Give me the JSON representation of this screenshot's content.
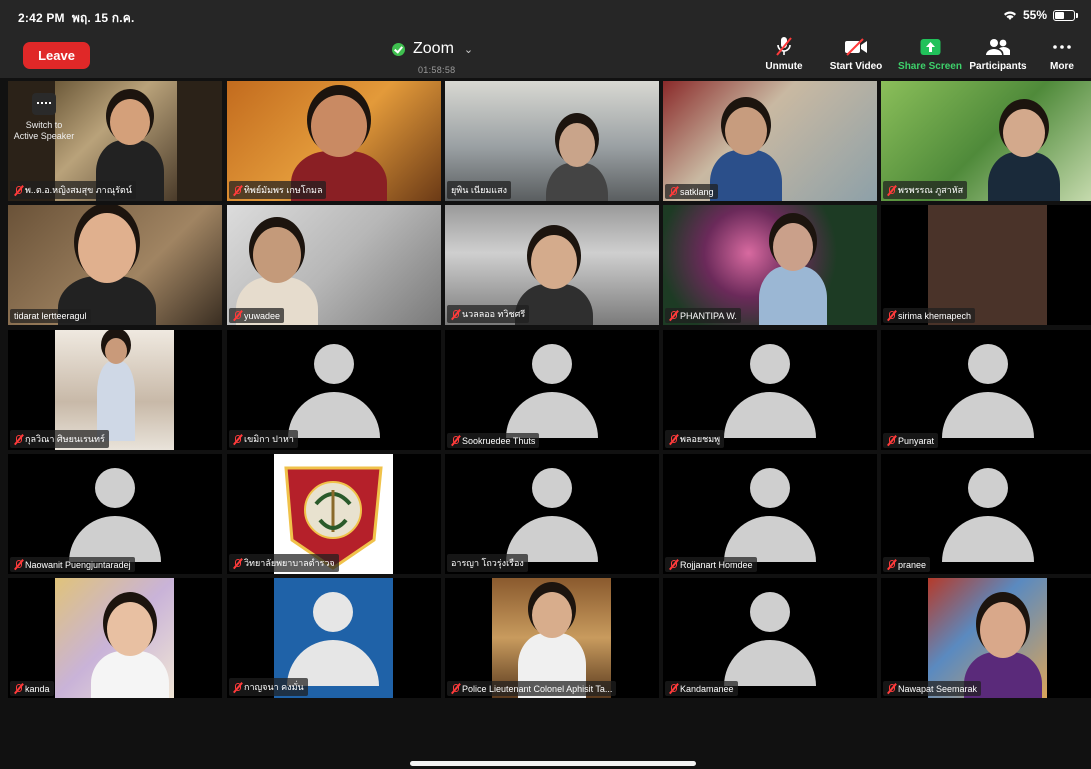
{
  "status": {
    "time": "2:42 PM",
    "date": "พฤ. 15 ก.ค.",
    "battery": "55%",
    "battery_level": 0.55
  },
  "toolbar": {
    "leave_label": "Leave",
    "meeting_title": "Zoom",
    "timer": "01:58:58",
    "controls": [
      {
        "label": "Unmute",
        "icon": "mic-muted-icon"
      },
      {
        "label": "Start Video",
        "icon": "video-off-icon"
      },
      {
        "label": "Share Screen",
        "icon": "share-screen-icon"
      },
      {
        "label": "Participants",
        "icon": "participants-icon"
      },
      {
        "label": "More",
        "icon": "more-icon"
      }
    ]
  },
  "active_speaker_label": "Switch to Active Speaker",
  "participants": [
    {
      "name": "พ..ต.อ.หญิงสมสุข ภาณุรัตน์",
      "muted": true,
      "video": true
    },
    {
      "name": "ทิพย์มัมพร เกษโกมล",
      "muted": true,
      "video": true
    },
    {
      "name": "ยุพิน เนียมแสง",
      "muted": false,
      "video": true
    },
    {
      "name": "satklang",
      "muted": true,
      "video": true
    },
    {
      "name": "พรพรรณ ภูสาหัส",
      "muted": true,
      "video": true
    },
    {
      "name": "tidarat lertteeragul",
      "muted": false,
      "video": true,
      "active": true
    },
    {
      "name": "yuwadee",
      "muted": true,
      "video": true
    },
    {
      "name": "นวลลออ ทวิชศรี",
      "muted": true,
      "video": true
    },
    {
      "name": "PHANTIPA W.",
      "muted": true,
      "video": true
    },
    {
      "name": "sirima khemapech",
      "muted": true,
      "video": false
    },
    {
      "name": "กุลวิณา ศิษยนเรนทร์",
      "muted": true,
      "video": true
    },
    {
      "name": "เขมิกา ปาหา",
      "muted": true,
      "video": false
    },
    {
      "name": "Sookruedee Thuts",
      "muted": true,
      "video": false
    },
    {
      "name": "พลอยชมพู",
      "muted": true,
      "video": false
    },
    {
      "name": "Punyarat",
      "muted": true,
      "video": false
    },
    {
      "name": "Naowanit Puengjuntaradej",
      "muted": true,
      "video": false
    },
    {
      "name": "วิทยาลัยพยาบาลตำรวจ",
      "muted": true,
      "video": true
    },
    {
      "name": "อารญา โถวรุ่งเรือง",
      "muted": false,
      "video": false
    },
    {
      "name": "Rojjanart Homdee",
      "muted": true,
      "video": false
    },
    {
      "name": "pranee",
      "muted": true,
      "video": false
    },
    {
      "name": "kanda",
      "muted": true,
      "video": true
    },
    {
      "name": "กาญจนา คงมั่น",
      "muted": true,
      "video": false
    },
    {
      "name": "Police Lieutenant Colonel Aphisit Ta...",
      "muted": true,
      "video": true
    },
    {
      "name": "Kandamanee",
      "muted": true,
      "video": false
    },
    {
      "name": "Nawapat Seemarak",
      "muted": true,
      "video": true
    }
  ]
}
